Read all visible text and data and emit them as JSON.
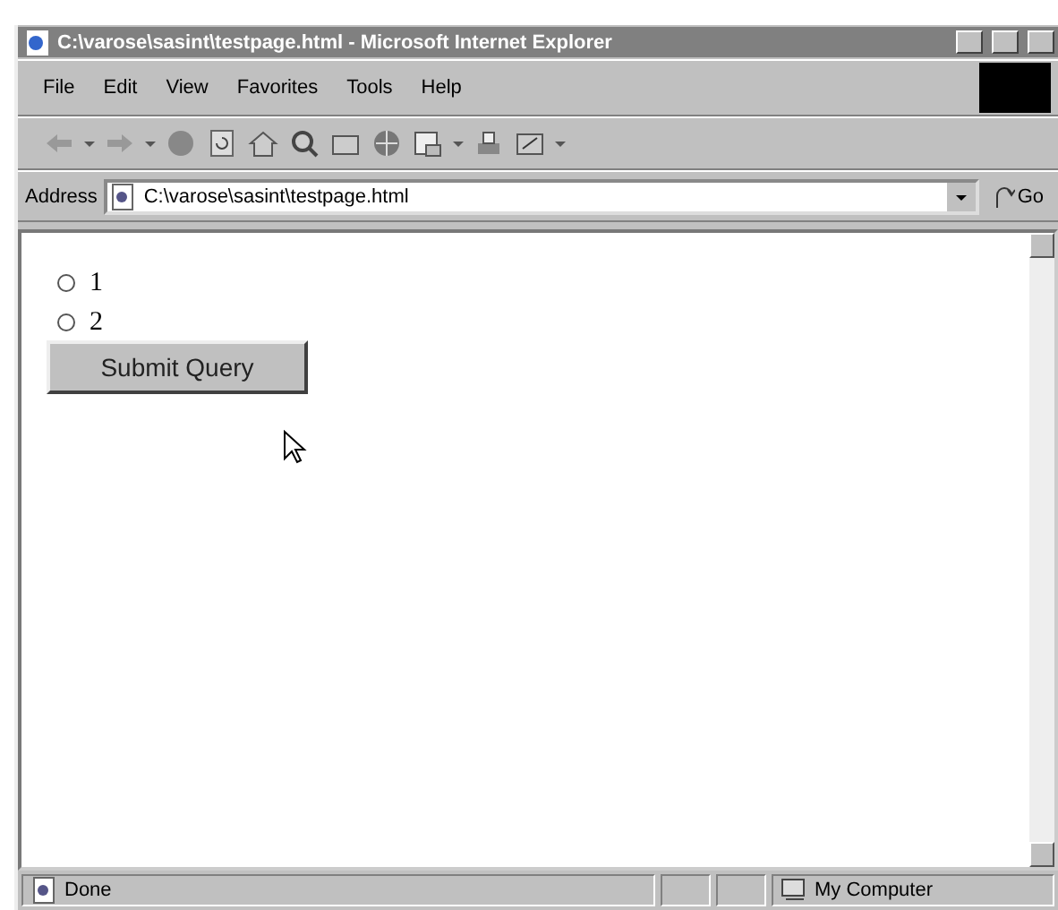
{
  "window": {
    "title": "C:\\varose\\sasint\\testpage.html - Microsoft Internet Explorer"
  },
  "menu": [
    "File",
    "Edit",
    "View",
    "Favorites",
    "Tools",
    "Help"
  ],
  "address": {
    "label": "Address",
    "value": "C:\\varose\\sasint\\testpage.html",
    "go": "Go"
  },
  "form": {
    "radios": [
      {
        "label": "1",
        "selected": false
      },
      {
        "label": "2",
        "selected": false
      }
    ],
    "submit": "Submit Query"
  },
  "status_bar": {
    "text": "Done",
    "zone": "My Computer"
  }
}
